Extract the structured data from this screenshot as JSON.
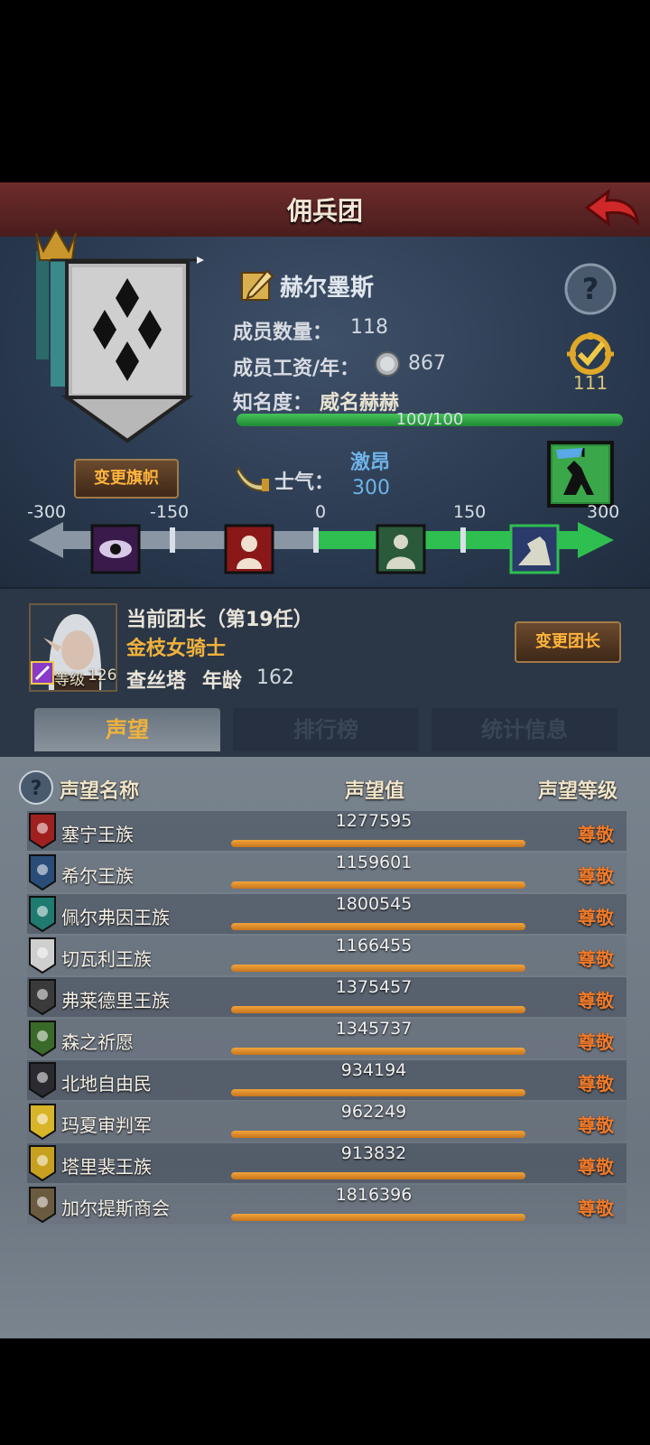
{
  "header": {
    "title": "佣兵团",
    "back_icon": "back-arrow-icon"
  },
  "guild": {
    "name": "赫尔墨斯",
    "members_label": "成员数量：",
    "members_value": "118",
    "salary_label": "成员工资/年：",
    "salary_value": "867",
    "fame_label": "知名度：",
    "fame_value": "威名赫赫",
    "fame_progress_text": "100/100",
    "fame_progress": 1.0,
    "medal_value": "111",
    "change_flag_label": "变更旗帜",
    "morale_label": "士气：",
    "morale_state": "激昂",
    "morale_value": "300",
    "scale_ticks": [
      "-300",
      "-150",
      "0",
      "150",
      "300"
    ],
    "morale_level": 300
  },
  "leader": {
    "title": "当前团长（第19任）",
    "rank": "金枝女骑士",
    "level_label": "等级",
    "level_value": "126",
    "name": "查丝塔",
    "age_label": "年龄",
    "age_value": "162",
    "change_leader_label": "变更团长"
  },
  "tabs": [
    {
      "label": "声望",
      "active": true
    },
    {
      "label": "排行榜",
      "active": false
    },
    {
      "label": "统计信息",
      "active": false
    }
  ],
  "table": {
    "headers": {
      "name": "声望名称",
      "value": "声望值",
      "level": "声望等级"
    },
    "rows": [
      {
        "name": "塞宁王族",
        "value": "1277595",
        "level": "尊敬",
        "icon": "red-crest-icon",
        "color": "#a02020"
      },
      {
        "name": "希尔王族",
        "value": "1159601",
        "level": "尊敬",
        "icon": "blue-crest-icon",
        "color": "#2a4c78"
      },
      {
        "name": "佩尔弗因王族",
        "value": "1800545",
        "level": "尊敬",
        "icon": "teal-moon-crest-icon",
        "color": "#1f7a70"
      },
      {
        "name": "切瓦利王族",
        "value": "1166455",
        "level": "尊敬",
        "icon": "scales-crest-icon",
        "color": "#cfcfcf"
      },
      {
        "name": "弗莱德里王族",
        "value": "1375457",
        "level": "尊敬",
        "icon": "dark-face-crest-icon",
        "color": "#3a3a3a"
      },
      {
        "name": "森之祈愿",
        "value": "1345737",
        "level": "尊敬",
        "icon": "tree-crest-icon",
        "color": "#3a6a2a"
      },
      {
        "name": "北地自由民",
        "value": "934194",
        "level": "尊敬",
        "icon": "axe-crest-icon",
        "color": "#2a2a30"
      },
      {
        "name": "玛夏审判军",
        "value": "962249",
        "level": "尊敬",
        "icon": "yellow-star-crest-icon",
        "color": "#d8b428"
      },
      {
        "name": "塔里裴王族",
        "value": "913832",
        "level": "尊敬",
        "icon": "yellow-crown-crest-icon",
        "color": "#c8a020"
      },
      {
        "name": "加尔提斯商会",
        "value": "1816396",
        "level": "尊敬",
        "icon": "chest-crest-icon",
        "color": "#6a5a40"
      }
    ]
  },
  "colors": {
    "accent": "#f0b23c",
    "progress_green": "#3cbf54",
    "reputation_level": "#f07a2a"
  }
}
